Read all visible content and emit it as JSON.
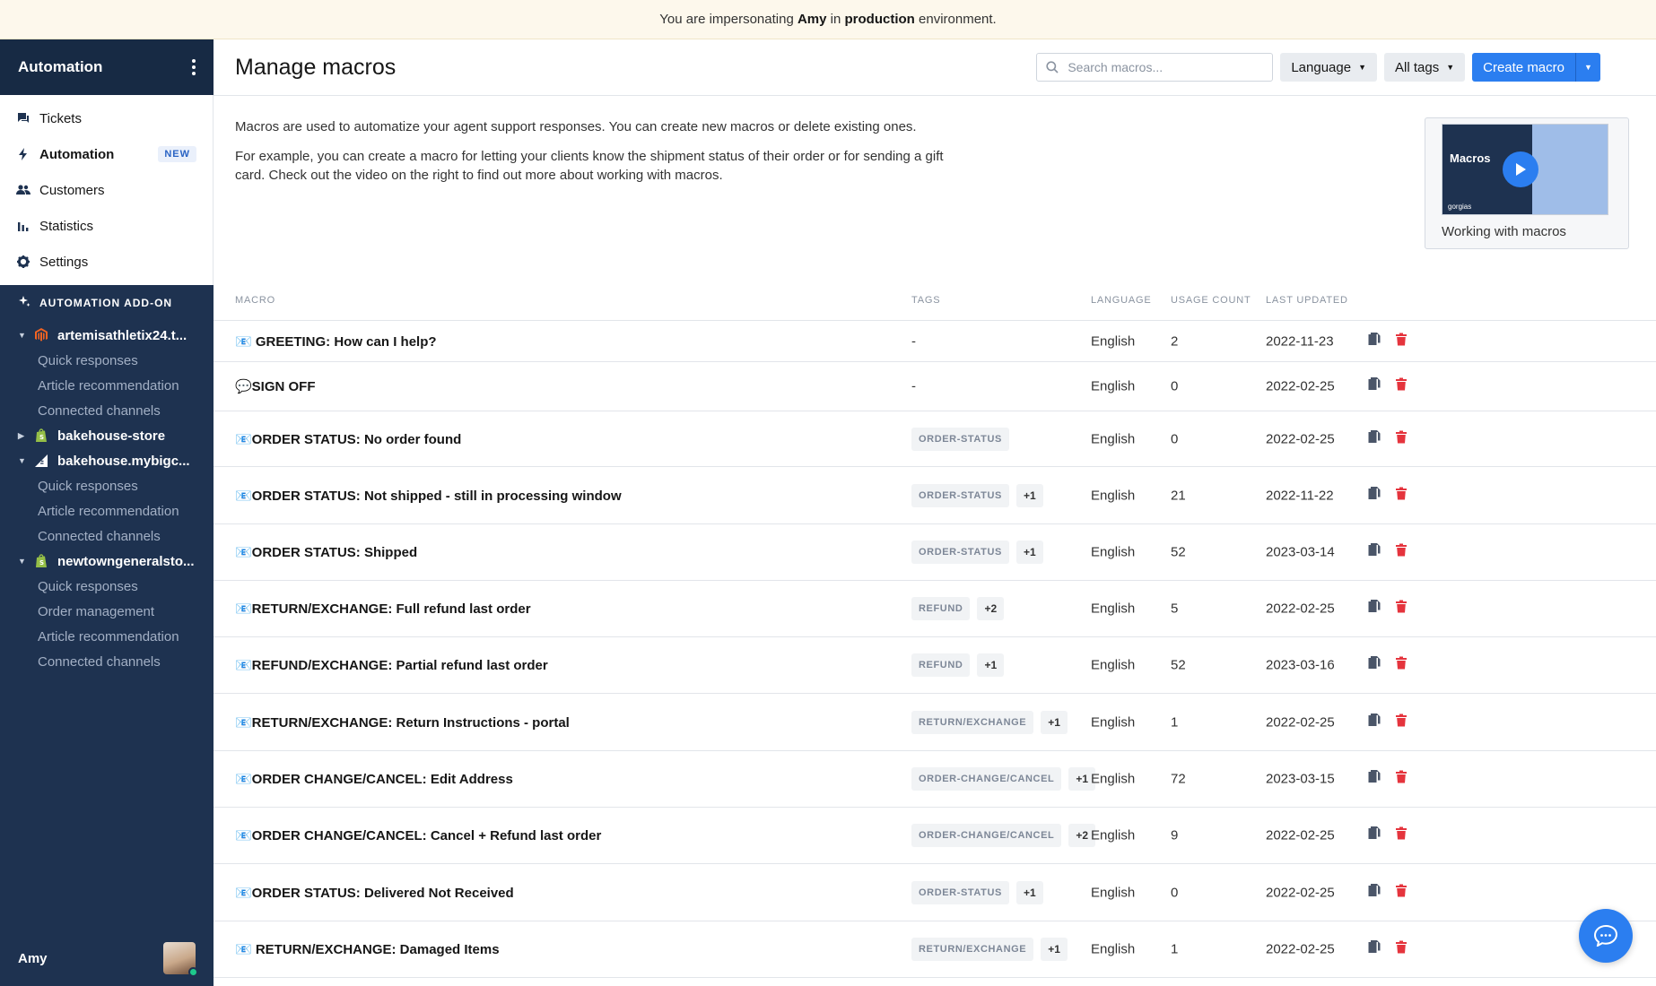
{
  "banner": {
    "prefix": "You are impersonating",
    "user": "Amy",
    "mid": "in",
    "env": "production",
    "suffix": "environment."
  },
  "sidebar": {
    "title": "Automation",
    "nav": [
      {
        "label": "Tickets",
        "icon": "tickets-icon"
      },
      {
        "label": "Automation",
        "icon": "bolt-icon",
        "badge": "NEW"
      },
      {
        "label": "Customers",
        "icon": "customers-icon"
      },
      {
        "label": "Statistics",
        "icon": "statistics-icon"
      },
      {
        "label": "Settings",
        "icon": "gear-icon"
      }
    ],
    "addon_title": "AUTOMATION ADD-ON",
    "stores": [
      {
        "name": "artemisathletix24.t...",
        "icon": "magento-icon",
        "expanded": true,
        "items": [
          "Quick responses",
          "Article recommendation",
          "Connected channels"
        ]
      },
      {
        "name": "bakehouse-store",
        "icon": "shopify-icon",
        "expanded": false,
        "items": []
      },
      {
        "name": "bakehouse.mybigc...",
        "icon": "bigcommerce-icon",
        "expanded": true,
        "items": [
          "Quick responses",
          "Article recommendation",
          "Connected channels"
        ]
      },
      {
        "name": "newtowngeneralsto...",
        "icon": "shopify-icon",
        "expanded": true,
        "items": [
          "Quick responses",
          "Order management",
          "Article recommendation",
          "Connected channels"
        ]
      }
    ],
    "user": "Amy"
  },
  "header": {
    "title": "Manage macros",
    "search_placeholder": "Search macros...",
    "language_label": "Language",
    "tags_label": "All tags",
    "create_label": "Create macro"
  },
  "intro": {
    "p1": "Macros are used to automatize your agent support responses. You can create new macros or delete existing ones.",
    "p2": "For example, you can create a macro for letting your clients know the shipment status of their order or for sending a gift card. Check out the video on the right to find out more about working with macros.",
    "video_thumb_title": "Macros",
    "video_brand": "gorgias",
    "video_caption": "Working with macros"
  },
  "table": {
    "columns": {
      "macro": "MACRO",
      "tags": "TAGS",
      "language": "LANGUAGE",
      "usage": "USAGE COUNT",
      "updated": "LAST UPDATED"
    },
    "rows": [
      {
        "name": "📧 GREETING: How can I help?",
        "tag": "-",
        "more": "",
        "language": "English",
        "usage": "2",
        "updated": "2022-11-23"
      },
      {
        "name": "💬SIGN OFF",
        "tag": "-",
        "more": "",
        "language": "English",
        "usage": "0",
        "updated": "2022-02-25"
      },
      {
        "name": "📧ORDER STATUS: No order found",
        "tag": "ORDER-STATUS",
        "more": "",
        "language": "English",
        "usage": "0",
        "updated": "2022-02-25"
      },
      {
        "name": "📧ORDER STATUS: Not shipped - still in processing window",
        "tag": "ORDER-STATUS",
        "more": "+1",
        "language": "English",
        "usage": "21",
        "updated": "2022-11-22"
      },
      {
        "name": "📧ORDER STATUS: Shipped",
        "tag": "ORDER-STATUS",
        "more": "+1",
        "language": "English",
        "usage": "52",
        "updated": "2023-03-14"
      },
      {
        "name": "📧RETURN/EXCHANGE: Full refund last order",
        "tag": "REFUND",
        "more": "+2",
        "language": "English",
        "usage": "5",
        "updated": "2022-02-25"
      },
      {
        "name": "📧REFUND/EXCHANGE: Partial refund last order",
        "tag": "REFUND",
        "more": "+1",
        "language": "English",
        "usage": "52",
        "updated": "2023-03-16"
      },
      {
        "name": "📧RETURN/EXCHANGE: Return Instructions - portal",
        "tag": "RETURN/EXCHANGE",
        "more": "+1",
        "language": "English",
        "usage": "1",
        "updated": "2022-02-25"
      },
      {
        "name": "📧ORDER CHANGE/CANCEL: Edit Address",
        "tag": "ORDER-CHANGE/CANCEL",
        "more": "+1",
        "language": "English",
        "usage": "72",
        "updated": "2023-03-15"
      },
      {
        "name": "📧ORDER CHANGE/CANCEL: Cancel + Refund last order",
        "tag": "ORDER-CHANGE/CANCEL",
        "more": "+2",
        "language": "English",
        "usage": "9",
        "updated": "2022-02-25"
      },
      {
        "name": "📧ORDER STATUS: Delivered Not Received",
        "tag": "ORDER-STATUS",
        "more": "+1",
        "language": "English",
        "usage": "0",
        "updated": "2022-02-25"
      },
      {
        "name": "📧 RETURN/EXCHANGE: Damaged Items",
        "tag": "RETURN/EXCHANGE",
        "more": "+1",
        "language": "English",
        "usage": "1",
        "updated": "2022-02-25"
      }
    ]
  },
  "colors": {
    "sidebar": "#1e3250",
    "primary": "#2b7ef0",
    "danger": "#e5343d",
    "banner": "#fdf8ec"
  }
}
